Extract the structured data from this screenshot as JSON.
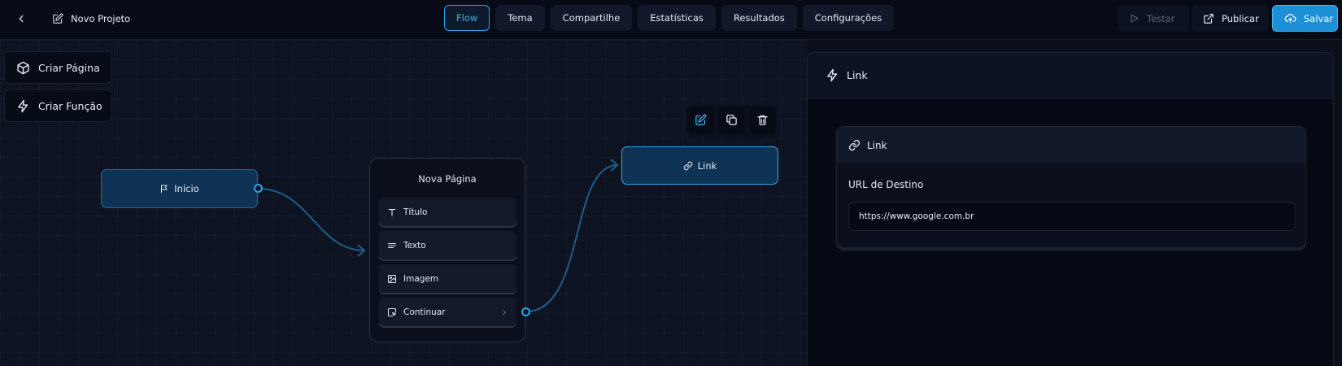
{
  "header": {
    "project_name": "Novo Projeto",
    "tabs": [
      {
        "label": "Flow",
        "active": true
      },
      {
        "label": "Tema",
        "active": false
      },
      {
        "label": "Compartilhe",
        "active": false
      },
      {
        "label": "Estatísticas",
        "active": false
      },
      {
        "label": "Resultados",
        "active": false
      },
      {
        "label": "Configurações",
        "active": false
      }
    ],
    "actions": {
      "test_label": "Testar",
      "publish_label": "Publicar",
      "save_label": "Salvar"
    }
  },
  "canvas": {
    "tools": {
      "create_page_label": "Criar Página",
      "create_function_label": "Criar Função"
    },
    "nodes": {
      "start": {
        "label": "Início"
      },
      "page": {
        "title": "Nova Página",
        "items": [
          {
            "label": "Título",
            "icon": "text-type-icon"
          },
          {
            "label": "Texto",
            "icon": "paragraph-icon"
          },
          {
            "label": "Imagem",
            "icon": "image-icon"
          },
          {
            "label": "Continuar",
            "icon": "continue-icon"
          }
        ]
      },
      "link": {
        "label": "Link"
      }
    }
  },
  "panel": {
    "title": "Link",
    "card": {
      "title": "Link",
      "field_label": "URL de Destino",
      "field_value": "https://www.google.com.br"
    }
  },
  "colors": {
    "accent": "#29a3e6",
    "save_button": "#1c8fd6",
    "node_fill": "#0e3354",
    "background": "#0b0f1a"
  }
}
